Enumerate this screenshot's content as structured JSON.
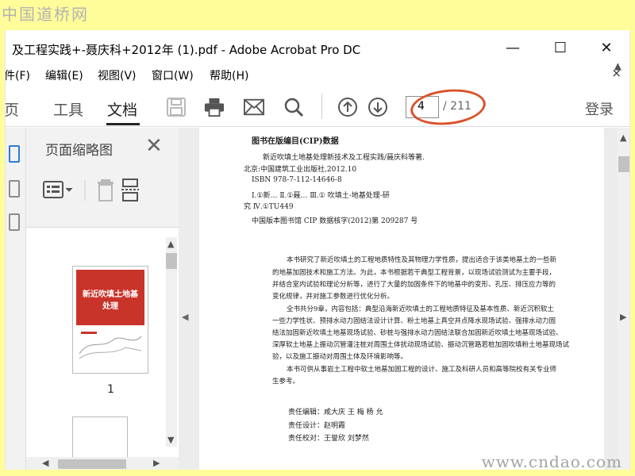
{
  "watermark": {
    "top": "中国道桥网",
    "bottom": "www.cndao.com"
  },
  "window": {
    "title": "及工程实践+-聂庆科+2012年 (1).pdf - Adobe Acrobat Pro DC",
    "minimize": "—",
    "maximize": "☐",
    "close": "✕"
  },
  "menu": {
    "items": [
      "件(F)",
      "编辑(E)",
      "视图(V)",
      "窗口(W)",
      "帮助(H)"
    ],
    "close_doc": "×"
  },
  "toolbar": {
    "tabs": [
      "主页",
      "工具",
      "文档"
    ],
    "tab_home_partial": "页",
    "page_current": "4",
    "page_total": "/ 211",
    "login": "登录"
  },
  "panel": {
    "title": "页面缩略图",
    "close": "✕",
    "thumbnail_label": "1",
    "cover_title": "新近吹填土地基处理"
  },
  "document": {
    "cip_title": "图书在版编目(CIP)数据",
    "cip_lines": [
      "新近吹填土地基处理新技术及工程实践/聂庆科等著.",
      "北京:中国建筑工业出版社,2012.10",
      "ISBN 978-7-112-14646-8",
      "Ⅰ.①新…  Ⅱ.①聂…  Ⅲ.① 吹填土-地基处理-研",
      "究  Ⅳ.①TU449",
      "中国版本图书馆 CIP 数据核字(2012)第 209287 号"
    ],
    "body_lines": [
      "本书研究了新近吹填土的工程地质特性及其物理力学性质，提出适合于该类地基土的一些新",
      "的地基加固技术和施工方法。为此，本书根据若干典型工程背景，以现场试验测试为主要手段，",
      "并结合室内试验和理论分析等，进行了大量的加固条件下的地基中的变形、孔压、排压应力等的",
      "变化规律，并对施工参数进行优化分析。",
      "全书共分9章，内容包括：典型沿海新近吹填土的工程地质特征及基本性质、新近沉积软土",
      "一些力学性状、预排水动力固结法设计计算、粉土地基上真空并点降水现场试验、强排水动力固",
      "结法加固新近吹填土地基现场试验、砂桩与强排水动力固结法联合加固新近吹填土地基现场试验、",
      "深厚软土地基上振动沉管灌注桩对周围土体扰动现场试验、振动沉管路若桩加固吹填粉土地基现场试",
      "验，以及施工振动对周围土体及环境影响等。",
      "本书可供从事岩土工程中软土地基加固工程的设计、施工及科研人员和高等院校有关专业师",
      "生参考。"
    ],
    "credits": [
      "责任编辑：咸大庆  王  梅  杨  允",
      "责任设计：赵明霞",
      "责任校对：王誉欣  刘梦然"
    ]
  }
}
